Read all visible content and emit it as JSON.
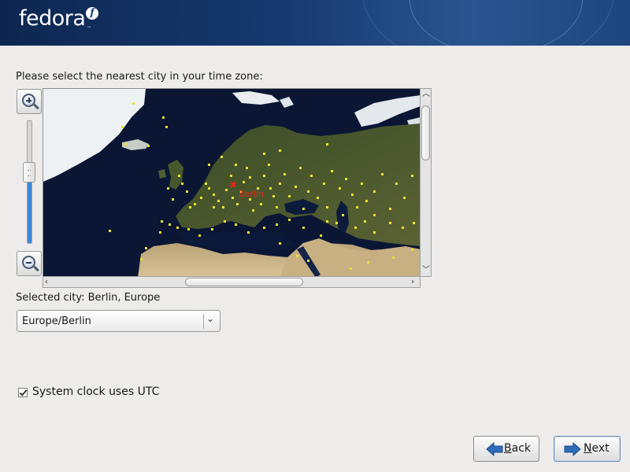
{
  "header": {
    "brand": "fedora",
    "trademark": "™"
  },
  "map_panel": {
    "prompt": "Please select the nearest city in your time zone:",
    "zoom_level": 0.58,
    "marked_city": "Berlin",
    "city_marker_color": "#e8241a",
    "city_dot_color": "#e7e32a"
  },
  "selection": {
    "selected_city_label": "Selected city: Berlin, Europe",
    "timezone_value": "Europe/Berlin"
  },
  "options": {
    "utc_label": "System clock uses UTC",
    "utc_checked": true
  },
  "navigation": {
    "back_mnemonic": "B",
    "back_rest": "ack",
    "next_mnemonic": "N",
    "next_rest": "ext",
    "arrow_color": "#2f6cb8"
  }
}
